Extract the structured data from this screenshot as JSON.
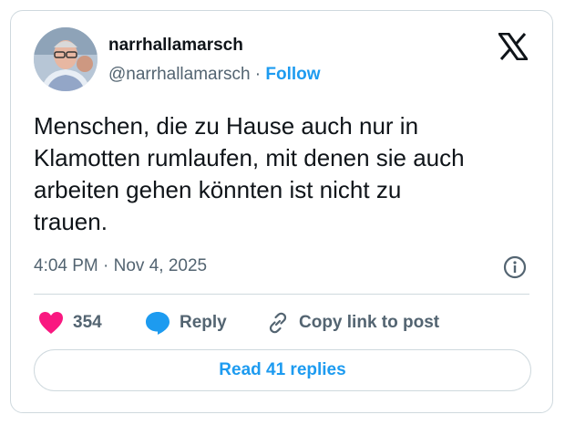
{
  "author": {
    "name": "narrhallamarsch",
    "handle": "@narrhallamarsch",
    "separator": "·",
    "follow_label": "Follow"
  },
  "post": {
    "text": "Menschen, die zu Hause auch nur in\nKlamotten rumlaufen, mit denen sie auch\narbeiten gehen könnten ist nicht zu\ntrauen.",
    "timestamp": "4:04 PM · Nov 4, 2025"
  },
  "actions": {
    "like_count": "354",
    "reply_label": "Reply",
    "copy_label": "Copy link to post"
  },
  "read_replies_label": "Read 41 replies",
  "colors": {
    "accent": "#1d9bf0",
    "heart": "#f91880",
    "secondary_text": "#536471",
    "border": "#cfd9de"
  },
  "icons": [
    "avatar",
    "x-logo-icon",
    "info-icon",
    "heart-icon",
    "reply-bubble-icon",
    "link-icon"
  ]
}
